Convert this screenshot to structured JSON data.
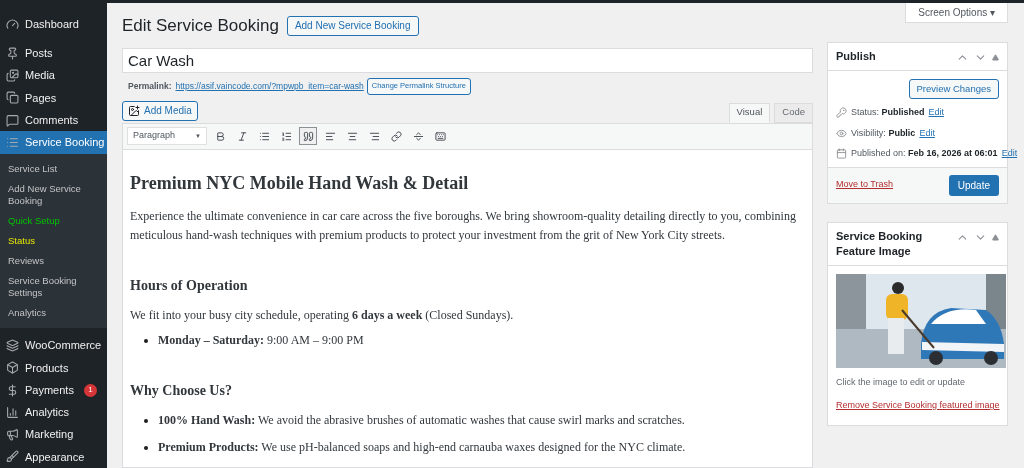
{
  "sidebar": {
    "items": [
      {
        "label": "Dashboard",
        "selected": false
      },
      {
        "label": "Posts",
        "selected": false
      },
      {
        "label": "Media",
        "selected": false
      },
      {
        "label": "Pages",
        "selected": false
      },
      {
        "label": "Comments",
        "selected": false
      },
      {
        "label": "Service Booking",
        "selected": true,
        "children": [
          {
            "label": "Service List",
            "kind": "normal"
          },
          {
            "label": "Add New Service Booking",
            "kind": "normal"
          },
          {
            "label": "Quick Setup",
            "kind": "setup"
          },
          {
            "label": "Status",
            "kind": "status"
          },
          {
            "label": "Reviews",
            "kind": "normal"
          },
          {
            "label": "Service Booking Settings",
            "kind": "normal"
          },
          {
            "label": "Analytics",
            "kind": "normal"
          }
        ]
      },
      {
        "label": "WooCommerce",
        "selected": false
      },
      {
        "label": "Products",
        "selected": false
      },
      {
        "label": "Payments",
        "selected": false,
        "badge": "1"
      },
      {
        "label": "Analytics",
        "selected": false
      },
      {
        "label": "Marketing",
        "selected": false
      },
      {
        "label": "Appearance",
        "selected": false
      }
    ]
  },
  "screen_options": "Screen Options ▾",
  "page_title": "Edit Service Booking",
  "add_new_button": "Add New Service Booking",
  "title_field": {
    "value": "Car Wash"
  },
  "permalink": {
    "label": "Permalink:",
    "url": "https://asif.vaincode.com/?mpwpb_item=car-wash",
    "button": "Change Permalink Structure"
  },
  "add_media_button": "Add Media",
  "editor_tabs": [
    {
      "label": "Visual",
      "selected": true
    },
    {
      "label": "Code",
      "selected": false
    }
  ],
  "toolbar": {
    "format": "Paragraph",
    "format_arrow": "▼",
    "buttons": [
      {
        "selected": false
      },
      {
        "selected": false
      },
      {
        "selected": false
      },
      {
        "selected": false
      },
      {
        "selected": true
      },
      {
        "selected": false
      },
      {
        "selected": false
      },
      {
        "selected": false
      },
      {
        "selected": false
      },
      {
        "selected": false
      },
      {
        "selected": false
      }
    ]
  },
  "content": [
    {
      "kind": "h2",
      "text": "Premium NYC Mobile Hand Wash & Detail"
    },
    {
      "kind": "p",
      "text": "Experience the ultimate convenience in car care across the five boroughs. We bring showroom-quality detailing directly to you, combining meticulous hand-wash techniques with premium products to protect your investment from the grit of New York City streets."
    },
    {
      "kind": "h3",
      "text": "Hours of Operation"
    },
    {
      "kind": "p",
      "text": "We fit into your busy city schedule, operating **6 days a week** (Closed Sundays)."
    },
    {
      "kind": "li",
      "text": "**Monday – Saturday:** 9:00 AM – 9:00 PM"
    },
    {
      "kind": "h3",
      "text": "Why Choose Us?"
    },
    {
      "kind": "li",
      "text": "**100% Hand Wash:** We avoid the abrasive brushes of automatic washes that cause swirl marks and scratches."
    },
    {
      "kind": "li",
      "text": "**Premium Products:** We use pH-balanced soaps and high-end carnauba waxes designed for the NYC climate."
    }
  ],
  "publish": {
    "title": "Publish",
    "preview_button": "Preview Changes",
    "rows": [
      {
        "label": "Status:",
        "value": "Published",
        "link": "Edit"
      },
      {
        "label": "Visibility:",
        "value": "Public",
        "link": "Edit"
      },
      {
        "label": "Published on:",
        "value": "Feb 16, 2026 at 06:01",
        "link": "Edit"
      }
    ],
    "trash_link": "Move to Trash",
    "update_button": "Update"
  },
  "feature_image": {
    "title": "Service Booking Feature Image",
    "hint": "Click the image to edit or update",
    "remove_link": "Remove Service Booking featured image"
  }
}
